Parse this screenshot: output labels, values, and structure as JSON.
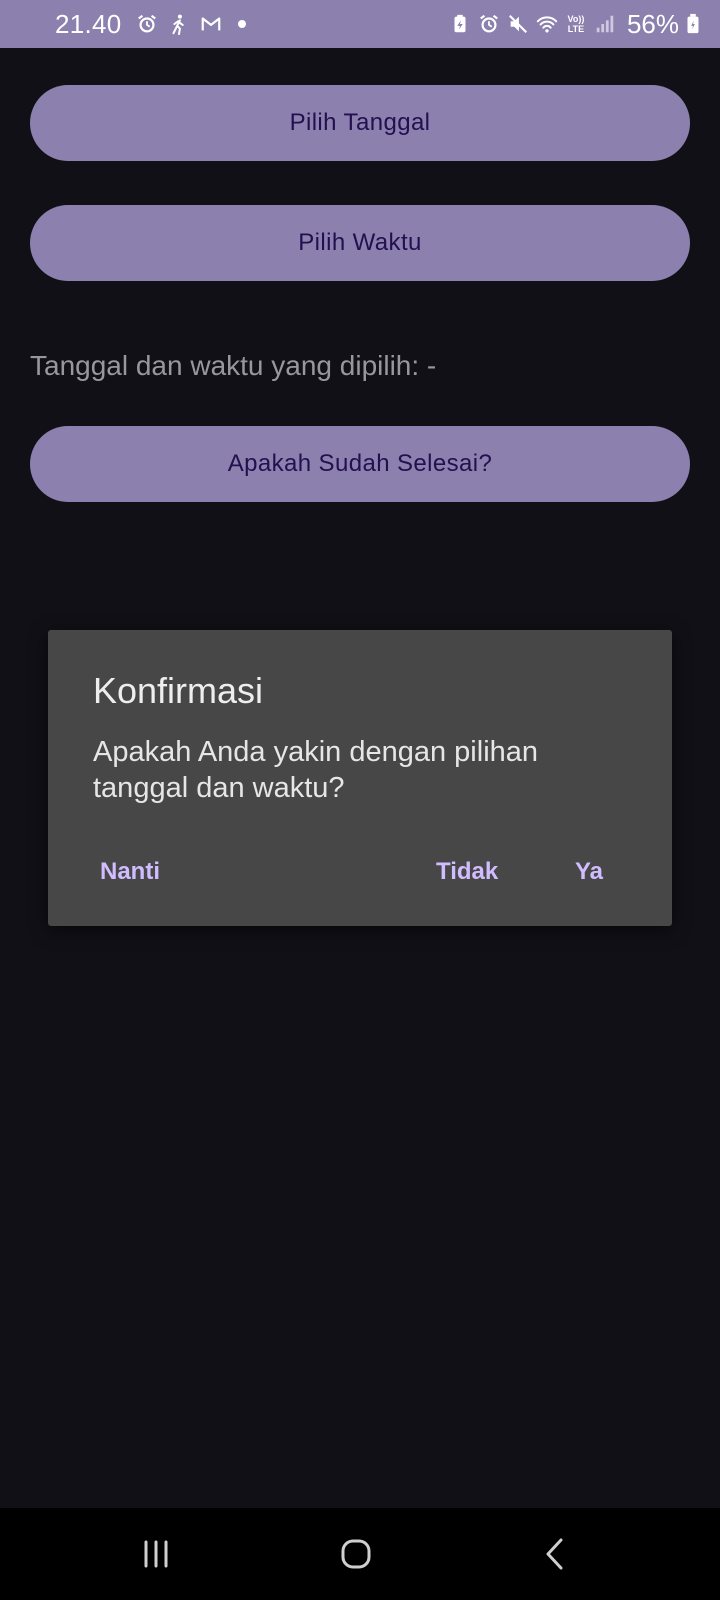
{
  "status_bar": {
    "time": "21.40",
    "battery": "56%",
    "volte_line1": "Vo))",
    "volte_line2": "LTE",
    "icons_left": [
      "alarm-icon",
      "walking-icon",
      "gmail-icon",
      "notification-dot"
    ],
    "icons_right": [
      "battery-saver-icon",
      "alarm-icon",
      "mute-icon",
      "wifi-icon",
      "volte-icon",
      "signal-icon",
      "battery-icon"
    ]
  },
  "main": {
    "pick_date_label": "Pilih Tanggal",
    "pick_time_label": "Pilih Waktu",
    "selected_text": "Tanggal dan waktu yang dipilih: -",
    "done_label": "Apakah Sudah Selesai?"
  },
  "dialog": {
    "title": "Konfirmasi",
    "message": "Apakah Anda yakin dengan pilihan tanggal dan waktu?",
    "later_label": "Nanti",
    "no_label": "Tidak",
    "yes_label": "Ya"
  },
  "nav_bar": {
    "icons": [
      "recents-icon",
      "home-icon",
      "back-icon"
    ]
  },
  "colors": {
    "background": "#111016",
    "accent": "#8c80af",
    "button_text": "#22104f",
    "dialog_background": "#474747",
    "dialog_button_text": "#d0bcff"
  }
}
